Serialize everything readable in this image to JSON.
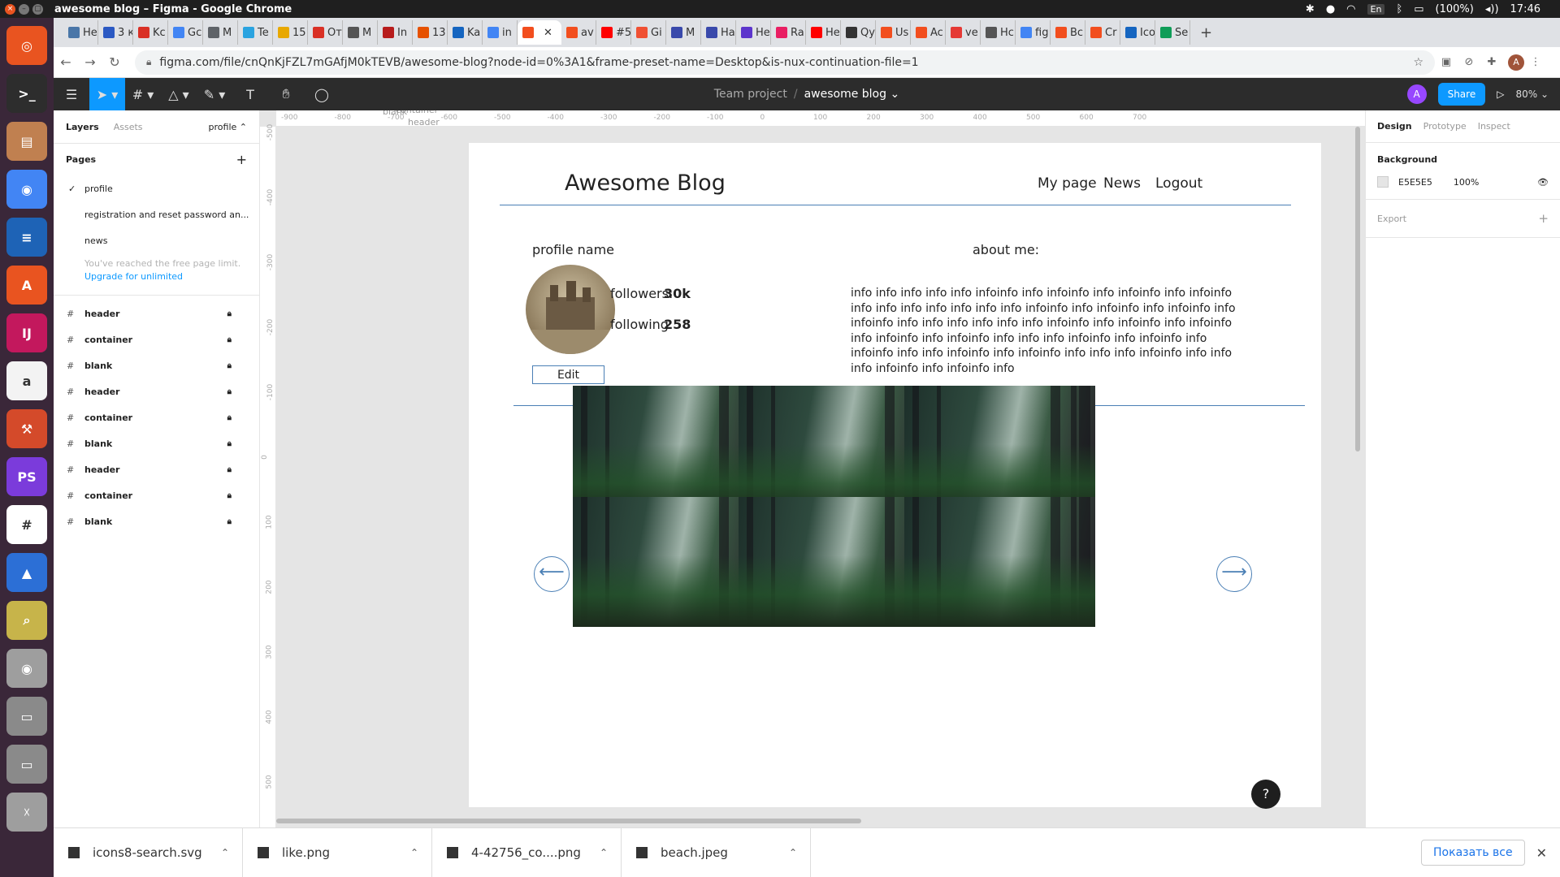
{
  "os": {
    "window_title": "awesome blog – Figma - Google Chrome",
    "tray": {
      "lang": "En",
      "battery": "(100%)",
      "time": "17:46"
    }
  },
  "browser": {
    "tabs": [
      {
        "label": "Hе",
        "color": "#4a76a8"
      },
      {
        "label": "3 к",
        "color": "#2b59c3"
      },
      {
        "label": "Kc",
        "color": "#d93025"
      },
      {
        "label": "Gс",
        "color": "#4285f4"
      },
      {
        "label": "M",
        "color": "#5f6368"
      },
      {
        "label": "Te",
        "color": "#2aa3e0"
      },
      {
        "label": "15",
        "color": "#e8a800"
      },
      {
        "label": "Oт",
        "color": "#d93025"
      },
      {
        "label": "M",
        "color": "#555555"
      },
      {
        "label": "In",
        "color": "#b71c1c"
      },
      {
        "label": "13",
        "color": "#e65100"
      },
      {
        "label": "Ka",
        "color": "#1565c0"
      },
      {
        "label": "in",
        "color": "#4285f4"
      },
      {
        "label": "",
        "color": "#f24e1e",
        "active": true
      },
      {
        "label": "av",
        "color": "#f24e1e"
      },
      {
        "label": "#5",
        "color": "#ff0000"
      },
      {
        "label": "Gi",
        "color": "#f05033"
      },
      {
        "label": "M",
        "color": "#3949ab"
      },
      {
        "label": "Hа",
        "color": "#3949ab"
      },
      {
        "label": "Hе",
        "color": "#5c35cc"
      },
      {
        "label": "Ra",
        "color": "#e91e63"
      },
      {
        "label": "Hе",
        "color": "#ff0000"
      },
      {
        "label": "Qу",
        "color": "#333333"
      },
      {
        "label": "Us",
        "color": "#f24e1e"
      },
      {
        "label": "Ac",
        "color": "#f24e1e"
      },
      {
        "label": "ve",
        "color": "#e53935"
      },
      {
        "label": "Hс",
        "color": "#555555"
      },
      {
        "label": "fig",
        "color": "#4285f4"
      },
      {
        "label": "Bс",
        "color": "#f24e1e"
      },
      {
        "label": "Cr",
        "color": "#f24e1e"
      },
      {
        "label": "Ico",
        "color": "#1565c0"
      },
      {
        "label": "Se",
        "color": "#0f9d58"
      }
    ],
    "url": "figma.com/file/cnQnKjFZL7mGAfjM0kTEVB/awesome-blog?node-id=0%3A1&frame-preset-name=Desktop&is-nux-continuation-file=1",
    "profile_initial": "A"
  },
  "dock": {
    "apps": [
      {
        "name": "ubuntu",
        "color": "#e95420",
        "glyph": "◎"
      },
      {
        "name": "terminal",
        "color": "#2d2d2d",
        "glyph": ">_"
      },
      {
        "name": "files",
        "color": "#c08050",
        "glyph": "▤"
      },
      {
        "name": "chrome",
        "color": "#4285f4",
        "glyph": "◉"
      },
      {
        "name": "writer",
        "color": "#1e63b6",
        "glyph": "≡"
      },
      {
        "name": "software",
        "color": "#e95420",
        "glyph": "A"
      },
      {
        "name": "intellij",
        "color": "#c3185d",
        "glyph": "IJ"
      },
      {
        "name": "amazon",
        "color": "#f3f3f3",
        "glyph": "a"
      },
      {
        "name": "tools",
        "color": "#d44a2a",
        "glyph": "⚒"
      },
      {
        "name": "phpstorm",
        "color": "#7b3bdb",
        "glyph": "PS"
      },
      {
        "name": "slack",
        "color": "#ffffff",
        "glyph": "#"
      },
      {
        "name": "app",
        "color": "#2c6fd6",
        "glyph": "▲"
      },
      {
        "name": "image-viewer",
        "color": "#c7b44a",
        "glyph": "⌕"
      },
      {
        "name": "camera",
        "color": "#9e9e9e",
        "glyph": "◉"
      },
      {
        "name": "drive-1",
        "color": "#8a8a8a",
        "glyph": "▭"
      },
      {
        "name": "drive-2",
        "color": "#8a8a8a",
        "glyph": "▭"
      },
      {
        "name": "trash",
        "color": "#9e9e9e",
        "glyph": "☓"
      }
    ]
  },
  "figma": {
    "breadcrumb": {
      "team": "Team project",
      "separator": "/",
      "file": "awesome blog ⌄"
    },
    "avatar_initial": "A",
    "share_label": "Share",
    "zoom": "80% ⌄",
    "left_panel": {
      "tabs": {
        "layers": "Layers",
        "assets": "Assets",
        "page": "profile ⌃"
      },
      "pages_heading": "Pages",
      "pages": [
        {
          "label": "profile",
          "selected": true
        },
        {
          "label": "registration and reset password an...",
          "selected": false
        },
        {
          "label": "news",
          "selected": false
        }
      ],
      "limit_note": "You've reached the free page limit.",
      "upgrade_link": "Upgrade for unlimited",
      "layers": [
        "header",
        "container",
        "blank",
        "header",
        "container",
        "blank",
        "header",
        "container",
        "blank"
      ]
    },
    "rulers": {
      "top": [
        "-900",
        "-800",
        "-700",
        "-600",
        "-500",
        "-400",
        "-300",
        "-200",
        "-100",
        "0",
        "100",
        "200",
        "300",
        "400",
        "500",
        "600",
        "700"
      ],
      "left": [
        "-500",
        "-400",
        "-300",
        "-200",
        "-100",
        "0",
        "100",
        "200",
        "300",
        "400",
        "500"
      ]
    },
    "frame_labels": {
      "container": "container",
      "blank": "blank",
      "header": "header"
    },
    "design": {
      "blog_title": "Awesome Blog",
      "nav": [
        "My page",
        "News",
        "Logout"
      ],
      "profile_name": "profile name",
      "followers_label": "followers:",
      "followers_value": "30k",
      "following_label": "following:",
      "following_value": "258",
      "edit_label": "Edit",
      "about_label": "about me:",
      "about_text": "info info info info info infoinfo info infoinfo info infoinfo info infoinfo info info info info info info info infoinfo info infoinfo info infoinfo info infoinfo info info info info info info infoinfo info infoinfo info infoinfo info infoinfo info infoinfo info info info infoinfo info infoinfo info infoinfo info info infoinfo info infoinfo info info info infoinfo info info info infoinfo info infoinfo info",
      "arrow_prev": "⟵",
      "arrow_next": "⟶"
    },
    "right_panel": {
      "tabs": {
        "design": "Design",
        "prototype": "Prototype",
        "inspect": "Inspect"
      },
      "background_heading": "Background",
      "background_hex": "E5E5E5",
      "background_opacity": "100%",
      "export_heading": "Export"
    },
    "help": "?"
  },
  "downloads": {
    "items": [
      "icons8-search.svg",
      "like.png",
      "4-42756_co....png",
      "beach.jpeg"
    ],
    "show_all": "Показать все"
  }
}
